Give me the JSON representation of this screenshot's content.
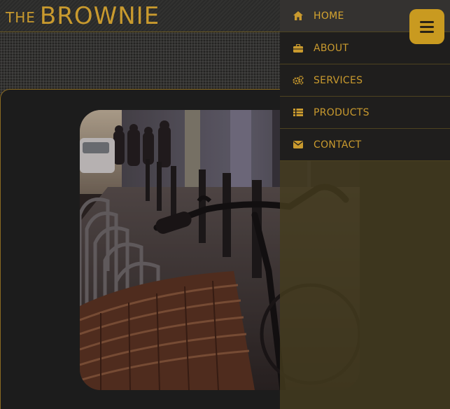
{
  "brand": {
    "prefix": "THE",
    "name": "BROWNIE"
  },
  "menu": {
    "items": [
      {
        "label": "HOME",
        "icon": "home-icon",
        "active": true
      },
      {
        "label": "ABOUT",
        "icon": "briefcase-icon",
        "active": false
      },
      {
        "label": "SERVICES",
        "icon": "gears-icon",
        "active": false
      },
      {
        "label": "PRODUCTS",
        "icon": "list-icon",
        "active": false
      },
      {
        "label": "CONTACT",
        "icon": "envelope-icon",
        "active": false
      }
    ],
    "toggle_icon": "hamburger-icon"
  },
  "colors": {
    "accent": "#c99a2e",
    "header_bg": "#2a2a29",
    "panel_bg": "#1c1c1c",
    "menu_bg": "#1f1e1d",
    "menu_active_bg": "#343230",
    "overlay": "rgba(68,60,30,0.82)",
    "toggle_bg": "#c99a20"
  },
  "photo": {
    "subject": "bicycle-parking-photo"
  }
}
